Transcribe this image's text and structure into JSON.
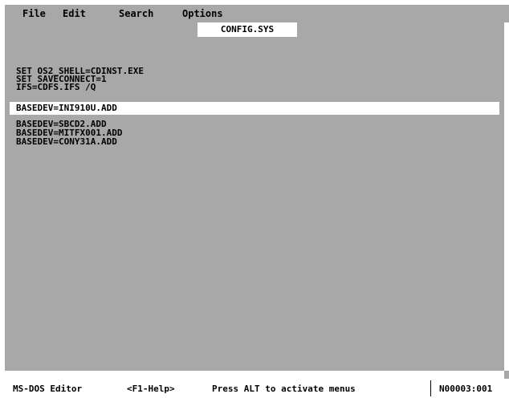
{
  "menu": {
    "items": [
      "File",
      "Edit",
      "Search",
      "Options"
    ]
  },
  "editor": {
    "title": "CONFIG.SYS",
    "lines": [
      "SET OS2_SHELL=CDINST.EXE",
      "SET SAVECONNECT=1",
      "IFS=CDFS.IFS /Q",
      "BASEDEV=INI910U.ADD",
      "BASEDEV=SBCD2.ADD",
      "BASEDEV=MITFX001.ADD",
      "BASEDEV=CONY31A.ADD"
    ],
    "current_line": 4
  },
  "status": {
    "app_name": "MS-DOS Editor",
    "help_hint": "<F1-Help>",
    "menu_hint": "Press ALT to activate menus",
    "position": "N00003:001"
  },
  "colors": {
    "background": "#a8a8a8",
    "highlight": "#ffffff",
    "text": "#000000",
    "frame": "#ffffff"
  }
}
